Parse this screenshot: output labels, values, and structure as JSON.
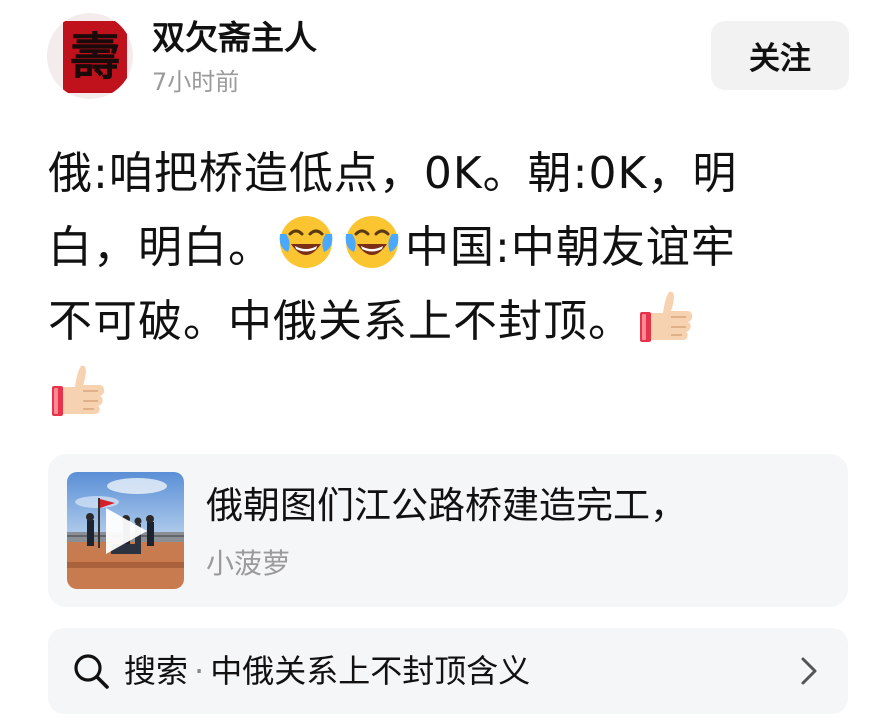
{
  "header": {
    "avatar_text": "壽",
    "author_name": "双欠斋主人",
    "post_time": "7小时前",
    "follow_label": "关注"
  },
  "post": {
    "line1": "俄:咱把桥造低点，0K。朝:0K，明",
    "line2_a": "白，明白。",
    "line2_b": "中国:中朝友谊牢",
    "line3": "不可破。中俄关系上不封顶。",
    "emojis": [
      "face-with-tears-of-joy-icon",
      "thumbs-up-icon"
    ]
  },
  "link_card": {
    "title": "俄朝图们江公路桥建造完工，",
    "source": "小菠萝"
  },
  "search": {
    "prefix": "搜索",
    "separator": "·",
    "query": "中俄关系上不封顶含义"
  },
  "colors": {
    "text": "#111111",
    "secondary": "#9a9a9a",
    "card_bg": "#f5f6f8",
    "button_bg": "#f2f2f2"
  }
}
